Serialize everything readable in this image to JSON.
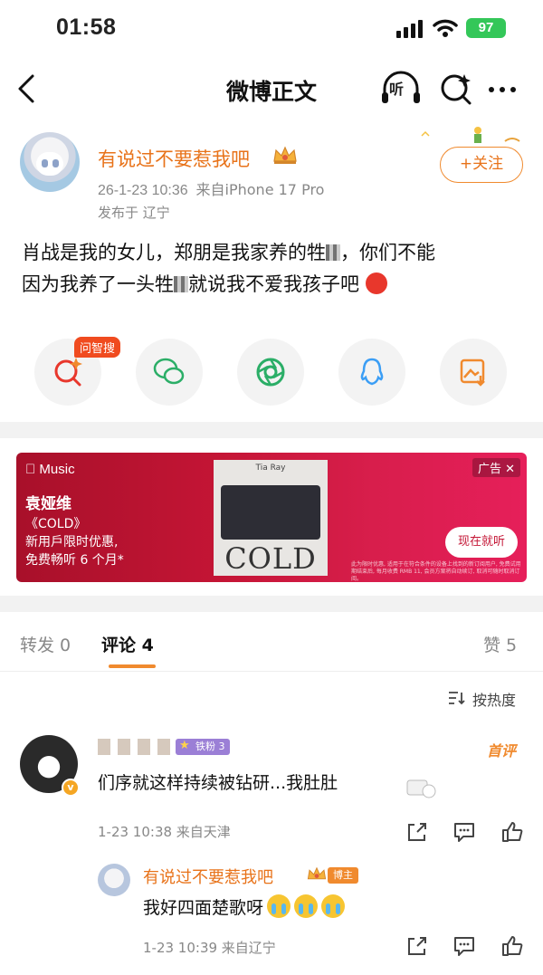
{
  "status_bar": {
    "time": "01:58",
    "battery": "97"
  },
  "nav": {
    "title": "微博正文",
    "listen_label": "听"
  },
  "post": {
    "author": "有说过不要惹我吧",
    "date": "26-1-23 10:36",
    "source": "来自iPhone 17 Pro",
    "location": "发布于 辽宁",
    "follow_label": "+关注",
    "text_line1_a": "肖战是我的女儿，郑朋是我家养的牲",
    "text_line1_b": "，你们不能",
    "text_line2_a": "因为我养了一头牲",
    "text_line2_b": "就说我不爱我孩子吧"
  },
  "share": {
    "ask_badge": "问智搜"
  },
  "ad": {
    "brand": "Music",
    "artist": "袁娅维",
    "album": "《COLD》",
    "line2": "新用戶限时优惠,",
    "line3": "免费畅听 6 个月*",
    "cover_title": "Tia Ray",
    "cover_word": "COLD",
    "label": "广告",
    "cta": "现在就听",
    "fine_print": "此为限时优惠, 适用于在符合条件的设备上找到的新订阅用户, 免费试用期结束后, 每月收费 RMB 11, 会员方案将自动续订, 取消可随时取消订阅。"
  },
  "tabs": {
    "repost": "转发 0",
    "comments": "评论 4",
    "likes": "赞 5"
  },
  "sort_label": "按热度",
  "comment": {
    "fan_badge": "铁粉 3",
    "first_badge": "首评",
    "text": "们序就这样持续被钻研...我肚肚",
    "time": "1-23 10:38 来自天津"
  },
  "reply": {
    "author": "有说过不要惹我吧",
    "badge": "博主",
    "text": "我好四面楚歌呀",
    "time": "1-23 10:39 来自辽宁"
  },
  "colors": {
    "accent": "#f08a2e",
    "name": "#e8731a",
    "ad_red": "#c41535",
    "battery": "#34c759"
  }
}
